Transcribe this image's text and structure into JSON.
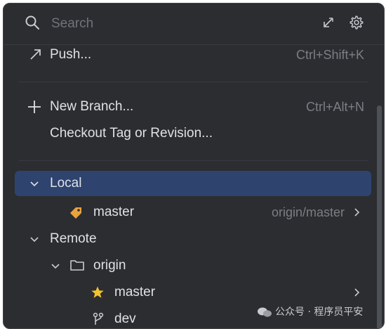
{
  "search": {
    "placeholder": "Search"
  },
  "actions": {
    "push": {
      "label": "Push...",
      "shortcut": "Ctrl+Shift+K"
    },
    "new_branch": {
      "label": "New Branch...",
      "shortcut": "Ctrl+Alt+N"
    },
    "checkout": {
      "label": "Checkout Tag or Revision..."
    }
  },
  "tree": {
    "local": {
      "label": "Local",
      "selected": true
    },
    "local_branches": [
      {
        "name": "master",
        "tracking": "origin/master",
        "icon": "tag-icon"
      }
    ],
    "remote": {
      "label": "Remote"
    },
    "origin": {
      "label": "origin",
      "icon": "folder-icon"
    },
    "remote_branches": [
      {
        "name": "master",
        "icon": "star-icon"
      },
      {
        "name": "dev",
        "icon": "branch-icon"
      }
    ]
  },
  "watermark": {
    "text": "公众号 · 程序员平安"
  },
  "colors": {
    "background": "#2b2d30",
    "selection": "#2e436e",
    "text": "#dfe1e5",
    "muted": "#7b7e85",
    "tag": "#e8a33d",
    "star": "#f2c230"
  }
}
